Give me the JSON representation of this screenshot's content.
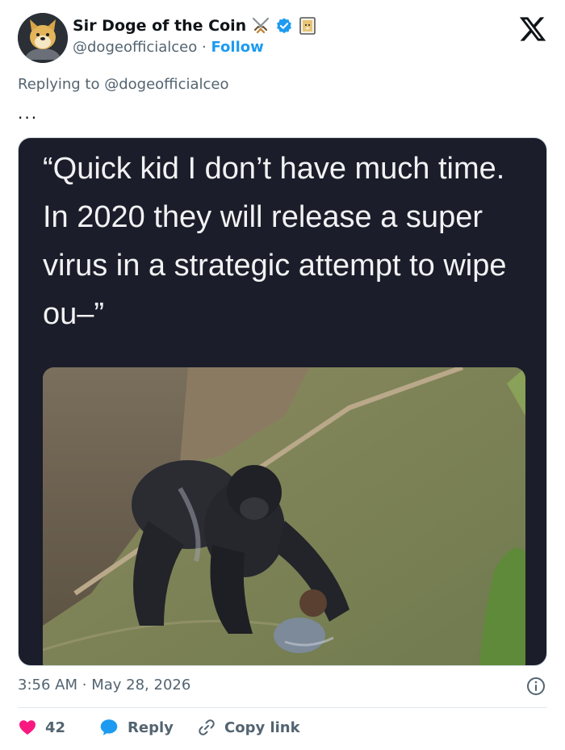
{
  "author": {
    "display_name": "Sir Doge of the Coin",
    "handle": "@dogeofficialceo",
    "separator": "·",
    "follow_label": "Follow",
    "badges": [
      "crossed-swords-icon",
      "verified-badge-icon",
      "framed-doge-icon"
    ]
  },
  "context": {
    "replying_prefix": "Replying to",
    "replying_handle": "@dogeofficialceo",
    "more": "..."
  },
  "media": {
    "quote_text": "“Quick kid I don’t have much time. In 2020 they will release a super virus in a strategic attempt to wipe ou–”",
    "photo_subject": "gorilla-with-child-photo"
  },
  "footer": {
    "time": "3:56 AM",
    "dot": "·",
    "date": "May 28, 2026"
  },
  "actions": {
    "like_count": "42",
    "reply_label": "Reply",
    "copy_label": "Copy link"
  },
  "colors": {
    "accent": "#1d9bf0",
    "like": "#f91880",
    "muted": "#536471",
    "media_bg": "#1b1d2a"
  }
}
